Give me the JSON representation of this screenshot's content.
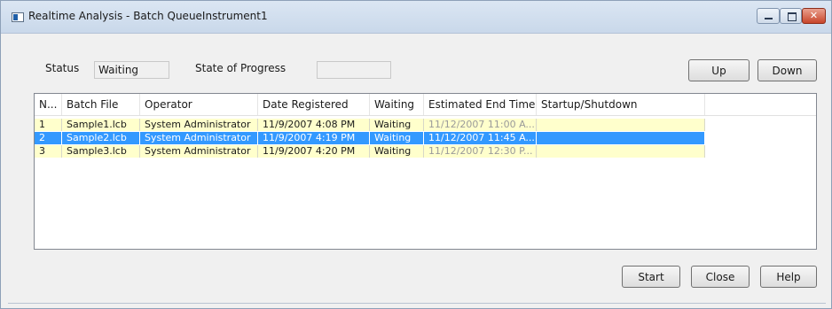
{
  "window": {
    "title": "Realtime Analysis - Batch QueueInstrument1"
  },
  "status": {
    "status_label": "Status",
    "status_value": "Waiting",
    "progress_label": "State of Progress",
    "progress_value": ""
  },
  "buttons": {
    "up": "Up",
    "down": "Down",
    "start": "Start",
    "close": "Close",
    "help": "Help"
  },
  "table": {
    "columns": [
      "N...",
      "Batch File",
      "Operator",
      "Date Registered",
      "Waiting",
      "Estimated End Time",
      "Startup/Shutdown"
    ],
    "rows": [
      {
        "no": "1",
        "batch_file": "Sample1.lcb",
        "operator": "System Administrator",
        "date_registered": "11/9/2007 4:08 PM",
        "waiting": "Waiting",
        "estimated_end": "11/12/2007 11:00 A...",
        "startup_shutdown": ""
      },
      {
        "no": "2",
        "batch_file": "Sample2.lcb",
        "operator": "System Administrator",
        "date_registered": "11/9/2007 4:19 PM",
        "waiting": "Waiting",
        "estimated_end": "11/12/2007 11:45 A...",
        "startup_shutdown": ""
      },
      {
        "no": "3",
        "batch_file": "Sample3.lcb",
        "operator": "System Administrator",
        "date_registered": "11/9/2007 4:20 PM",
        "waiting": "Waiting",
        "estimated_end": "11/12/2007 12:30 P...",
        "startup_shutdown": ""
      }
    ],
    "selected_row_index": 1
  },
  "colors": {
    "row_highlight": "#ffffcc",
    "selection": "#3399ff",
    "dim_text": "#9a9a9a"
  },
  "icons": {
    "app": "app-window-icon",
    "minimize": "minimize-icon",
    "maximize": "maximize-icon",
    "close": "close-icon"
  }
}
